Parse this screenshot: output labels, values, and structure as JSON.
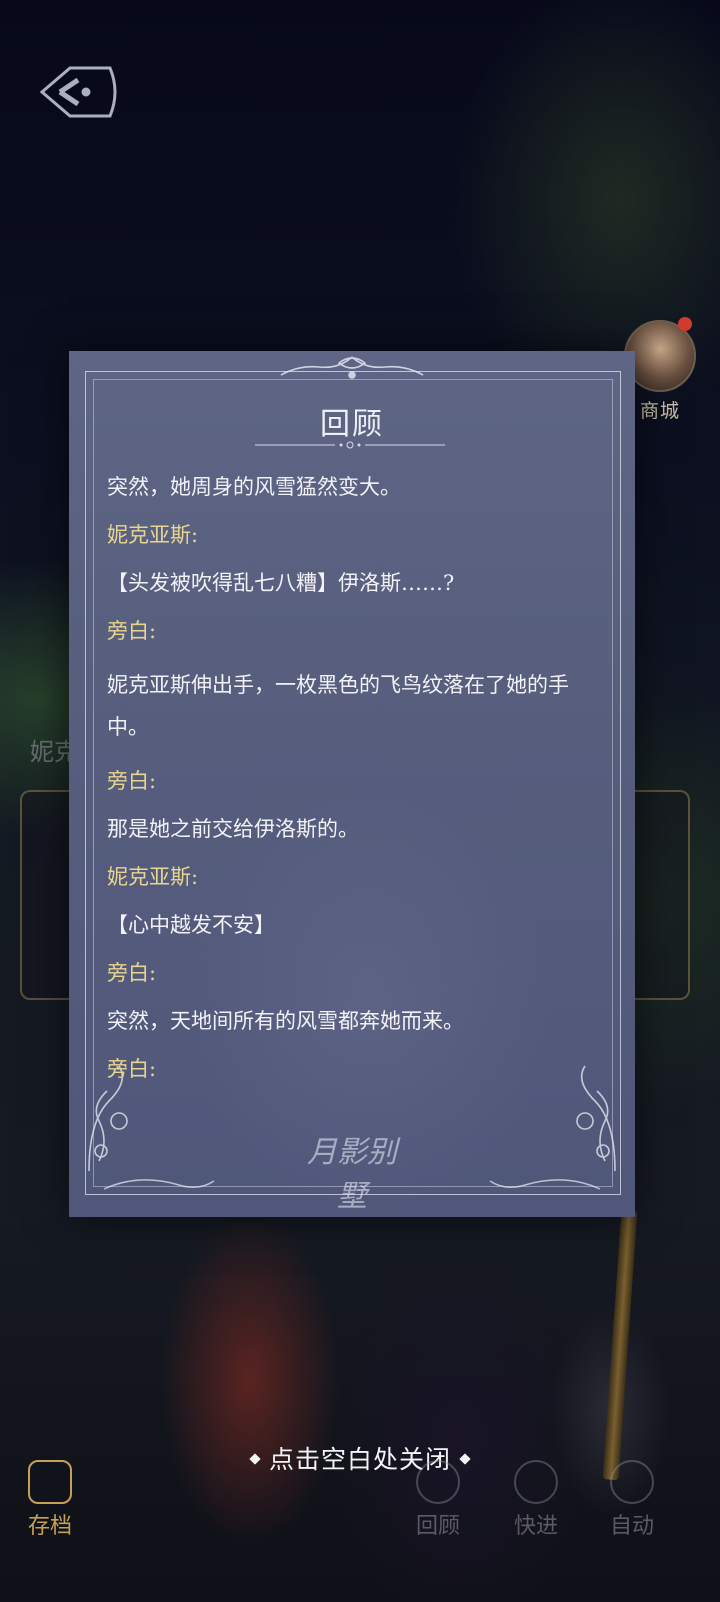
{
  "shop": {
    "label": "商城"
  },
  "modal": {
    "title": "回顾",
    "entries": [
      {
        "type": "line",
        "text": "突然，她周身的风雪猛然变大。"
      },
      {
        "type": "speaker",
        "text": "妮克亚斯:"
      },
      {
        "type": "line",
        "text": "【头发被吹得乱七八糟】伊洛斯……?"
      },
      {
        "type": "speaker",
        "text": "旁白:"
      },
      {
        "type": "line",
        "text": "妮克亚斯伸出手，一枚黑色的飞鸟纹落在了她的手中。"
      },
      {
        "type": "speaker",
        "text": "旁白:"
      },
      {
        "type": "line",
        "text": "那是她之前交给伊洛斯的。"
      },
      {
        "type": "speaker",
        "text": "妮克亚斯:"
      },
      {
        "type": "line",
        "text": "【心中越发不安】"
      },
      {
        "type": "speaker",
        "text": "旁白:"
      },
      {
        "type": "line",
        "text": "突然，天地间所有的风雪都奔她而来。"
      },
      {
        "type": "speaker",
        "text": "旁白:"
      }
    ],
    "logo_text": "月影别墅"
  },
  "behind": {
    "name_partial": "妮克亚斯"
  },
  "close_hint": "点击空白处关闭",
  "bottom_bar": {
    "save": "存档",
    "review": "回顾",
    "skip": "快进",
    "auto": "自动"
  },
  "colors": {
    "speaker": "#e8d690",
    "dialog_text": "#f2f2f6",
    "modal_bg": "#565d7d"
  }
}
